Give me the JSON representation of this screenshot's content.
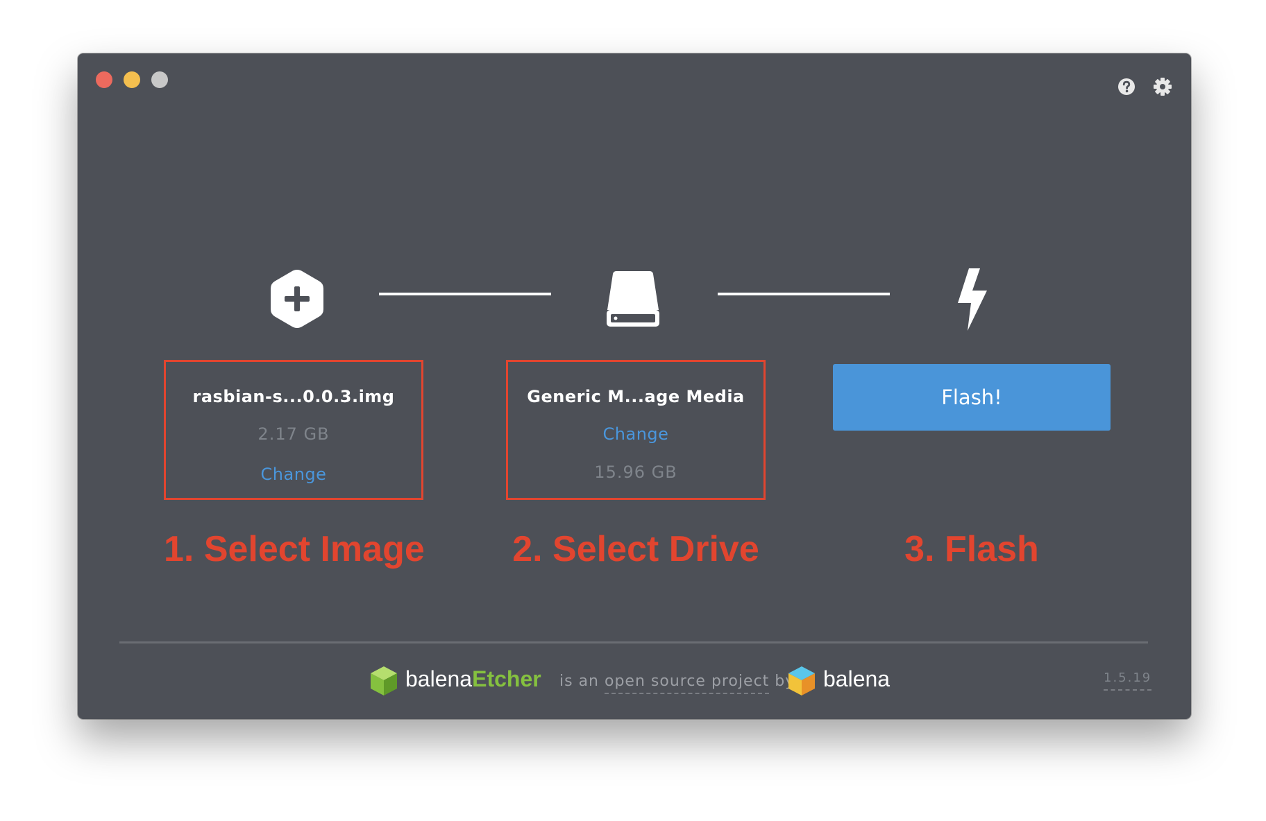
{
  "window": {
    "controls": [
      "close",
      "minimize",
      "maximize"
    ]
  },
  "header": {
    "icons": [
      "help-icon",
      "gear-icon"
    ]
  },
  "steps": {
    "image": {
      "icon": "plus-hexagon-icon",
      "name": "rasbian-s...0.0.3.img",
      "size": "2.17 GB",
      "change_label": "Change",
      "title": "1. Select Image"
    },
    "drive": {
      "icon": "drive-icon",
      "name": "Generic M...age Media",
      "change_label": "Change",
      "size": "15.96 GB",
      "title": "2. Select Drive"
    },
    "flash": {
      "icon": "lightning-icon",
      "button_label": "Flash!",
      "title": "3. Flash"
    }
  },
  "footer": {
    "etcher_brand_prefix": "balena",
    "etcher_brand_suffix": "Etcher",
    "open_source_prefix": "is an ",
    "open_source_link": "open source project",
    "open_source_suffix": " by",
    "balena_brand": "balena",
    "version": "1.5.19"
  },
  "colors": {
    "window_bg": "#4d5057",
    "accent_blue": "#4a95d9",
    "annotation_red": "#e2452f",
    "etcher_green": "#85c13f"
  }
}
